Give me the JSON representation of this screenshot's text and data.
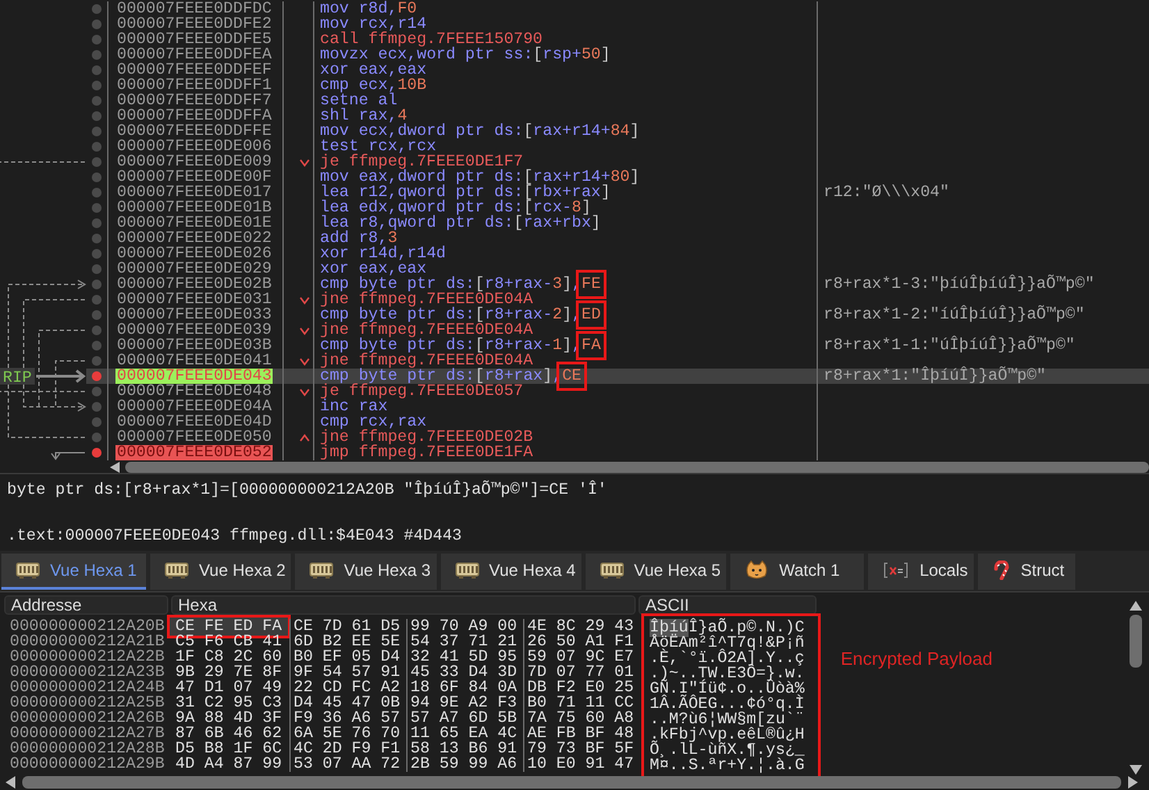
{
  "disassembly": {
    "rip_label": "RIP",
    "rows": [
      {
        "address": "000007FEEE0DDFDC",
        "instruction": "mov r8d,F0",
        "kind": "plain",
        "boxed": false,
        "breakpoint": false,
        "current": false
      },
      {
        "address": "000007FEEE0DDFE2",
        "instruction": "mov rcx,r14",
        "kind": "plain",
        "boxed": false,
        "breakpoint": false,
        "current": false
      },
      {
        "address": "000007FEEE0DDFE5",
        "instruction": "call ffmpeg.7FEEE150790",
        "kind": "branch",
        "boxed": false,
        "breakpoint": false,
        "current": false
      },
      {
        "address": "000007FEEE0DDFEA",
        "instruction": "movzx ecx,word ptr ss:[rsp+50]",
        "kind": "plain",
        "boxed": false,
        "breakpoint": false,
        "current": false
      },
      {
        "address": "000007FEEE0DDFEF",
        "instruction": "xor eax,eax",
        "kind": "plain",
        "boxed": false,
        "breakpoint": false,
        "current": false
      },
      {
        "address": "000007FEEE0DDFF1",
        "instruction": "cmp ecx,10B",
        "kind": "plain",
        "boxed": false,
        "breakpoint": false,
        "current": false
      },
      {
        "address": "000007FEEE0DDFF7",
        "instruction": "setne al",
        "kind": "plain",
        "boxed": false,
        "breakpoint": false,
        "current": false
      },
      {
        "address": "000007FEEE0DDFFA",
        "instruction": "shl rax,4",
        "kind": "plain",
        "boxed": false,
        "breakpoint": false,
        "current": false
      },
      {
        "address": "000007FEEE0DDFFE",
        "instruction": "mov ecx,dword ptr ds:[rax+r14+84]",
        "kind": "plain",
        "boxed": false,
        "breakpoint": false,
        "current": false
      },
      {
        "address": "000007FEEE0DE006",
        "instruction": "test rcx,rcx",
        "kind": "plain",
        "boxed": false,
        "breakpoint": false,
        "current": false
      },
      {
        "address": "000007FEEE0DE009",
        "instruction": "je ffmpeg.7FEEE0DE1F7",
        "kind": "jump_down",
        "boxed": false,
        "breakpoint": false,
        "current": false
      },
      {
        "address": "000007FEEE0DE00F",
        "instruction": "mov eax,dword ptr ds:[rax+r14+80]",
        "kind": "plain",
        "boxed": false,
        "breakpoint": false,
        "current": false
      },
      {
        "address": "000007FEEE0DE017",
        "instruction": "lea r12,qword ptr ds:[rbx+rax]",
        "kind": "plain",
        "boxed": false,
        "breakpoint": false,
        "current": false,
        "comment": "r12:\"Ø\\\\\\x04\""
      },
      {
        "address": "000007FEEE0DE01B",
        "instruction": "lea edx,qword ptr ds:[rcx-8]",
        "kind": "plain",
        "boxed": false,
        "breakpoint": false,
        "current": false
      },
      {
        "address": "000007FEEE0DE01E",
        "instruction": "lea r8,qword ptr ds:[rax+rbx]",
        "kind": "plain",
        "boxed": false,
        "breakpoint": false,
        "current": false
      },
      {
        "address": "000007FEEE0DE022",
        "instruction": "add r8,3",
        "kind": "plain",
        "boxed": false,
        "breakpoint": false,
        "current": false
      },
      {
        "address": "000007FEEE0DE026",
        "instruction": "xor r14d,r14d",
        "kind": "plain",
        "boxed": false,
        "breakpoint": false,
        "current": false
      },
      {
        "address": "000007FEEE0DE029",
        "instruction": "xor eax,eax",
        "kind": "plain",
        "boxed": false,
        "breakpoint": false,
        "current": false
      },
      {
        "address": "000007FEEE0DE02B",
        "instruction": "cmp byte ptr ds:[r8+rax-3],FE",
        "kind": "plain",
        "boxed": true,
        "breakpoint": false,
        "current": false,
        "comment": "r8+rax*1-3:\"þíúÎþíúÎ}}aÕ™p©\""
      },
      {
        "address": "000007FEEE0DE031",
        "instruction": "jne ffmpeg.7FEEE0DE04A",
        "kind": "jump_down",
        "boxed": false,
        "breakpoint": false,
        "current": false
      },
      {
        "address": "000007FEEE0DE033",
        "instruction": "cmp byte ptr ds:[r8+rax-2],ED",
        "kind": "plain",
        "boxed": true,
        "breakpoint": false,
        "current": false,
        "comment": "r8+rax*1-2:\"íúÎþíúÎ}}aÕ™p©\""
      },
      {
        "address": "000007FEEE0DE039",
        "instruction": "jne ffmpeg.7FEEE0DE04A",
        "kind": "jump_down",
        "boxed": false,
        "breakpoint": false,
        "current": false
      },
      {
        "address": "000007FEEE0DE03B",
        "instruction": "cmp byte ptr ds:[r8+rax-1],FA",
        "kind": "plain",
        "boxed": true,
        "breakpoint": false,
        "current": false,
        "comment": "r8+rax*1-1:\"úÎþíúÎ}}aÕ™p©\""
      },
      {
        "address": "000007FEEE0DE041",
        "instruction": "jne ffmpeg.7FEEE0DE04A",
        "kind": "jump_down",
        "boxed": false,
        "breakpoint": false,
        "current": false
      },
      {
        "address": "000007FEEE0DE043",
        "instruction": "cmp byte ptr ds:[r8+rax],CE",
        "kind": "plain",
        "boxed": true,
        "breakpoint": true,
        "current": true,
        "comment": "r8+rax*1:\"ÎþíúÎ}}aÕ™p©\""
      },
      {
        "address": "000007FEEE0DE048",
        "instruction": "je ffmpeg.7FEEE0DE057",
        "kind": "jump_down",
        "boxed": false,
        "breakpoint": false,
        "current": false
      },
      {
        "address": "000007FEEE0DE04A",
        "instruction": "inc rax",
        "kind": "plain",
        "boxed": false,
        "breakpoint": false,
        "current": false
      },
      {
        "address": "000007FEEE0DE04D",
        "instruction": "cmp rcx,rax",
        "kind": "plain",
        "boxed": false,
        "breakpoint": false,
        "current": false
      },
      {
        "address": "000007FEEE0DE050",
        "instruction": "jne ffmpeg.7FEEE0DE02B",
        "kind": "jump_up",
        "boxed": false,
        "breakpoint": false,
        "current": false
      },
      {
        "address": "000007FEEE0DE052",
        "instruction": "jmp ffmpeg.7FEEE0DE1FA",
        "kind": "branch",
        "boxed": false,
        "breakpoint": true,
        "current": false
      }
    ]
  },
  "info": {
    "lines": [
      "byte ptr ds:[r8+rax*1]=[000000000212A20B \"ÎþíúÎ}aÕ™p©\"]=CE 'Î'",
      ".text:000007FEEE0DE043 ffmpeg.dll:$4E043 #4D443"
    ]
  },
  "tabs": [
    {
      "label": "Vue Hexa 1",
      "kind": "dump",
      "selected": true
    },
    {
      "label": "Vue Hexa 2",
      "kind": "dump",
      "selected": false
    },
    {
      "label": "Vue Hexa 3",
      "kind": "dump",
      "selected": false
    },
    {
      "label": "Vue Hexa 4",
      "kind": "dump",
      "selected": false
    },
    {
      "label": "Vue Hexa 5",
      "kind": "dump",
      "selected": false
    },
    {
      "label": "Watch 1",
      "kind": "watch",
      "selected": false
    },
    {
      "label": "Locals",
      "kind": "locals",
      "selected": false
    },
    {
      "label": "Struct",
      "kind": "struct",
      "selected": false
    }
  ],
  "hex": {
    "columns": [
      "Addresse",
      "Hexa",
      "ASCII"
    ],
    "note": "Encrypted Payload",
    "rows": [
      {
        "address": "000000000212A20B",
        "groups": [
          "CE FE ED FA",
          "CE 7D 61 D5",
          "99 70 A9 00",
          "4E 8C 29 43"
        ],
        "ascii": "ÎþíúÎ}aÕ.p©.N.)C",
        "boxed": true
      },
      {
        "address": "000000000212A21B",
        "groups": [
          "C5 F6 CB 41",
          "6D B2 EE 5E",
          "54 37 71 21",
          "26 50 A1 F1"
        ],
        "ascii": "ÅöËAm²î^T7q!&P¡ñ",
        "boxed": false
      },
      {
        "address": "000000000212A22B",
        "groups": [
          "1F C8 2C 60",
          "B0 EF 05 D4",
          "32 41 5D 95",
          "59 07 9C E7"
        ],
        "ascii": ".È,`°ï.Ô2A].Y..ç",
        "boxed": false
      },
      {
        "address": "000000000212A23B",
        "groups": [
          "9B 29 7E 8F",
          "9F 54 57 91",
          "45 33 D4 3D",
          "7D 07 77 01"
        ],
        "ascii": ".)~..TW.E3Ô=}.w.",
        "boxed": false
      },
      {
        "address": "000000000212A24B",
        "groups": [
          "47 D1 07 49",
          "22 CD FC A2",
          "18 6F 84 0A",
          "DB F2 E0 25"
        ],
        "ascii": "GÑ.I\"Íü¢.o..Ûòà%",
        "boxed": false
      },
      {
        "address": "000000000212A25B",
        "groups": [
          "31 C2 95 C3",
          "D4 45 47 0B",
          "94 9E A2 F3",
          "B0 71 11 CC"
        ],
        "ascii": "1Â.ÃÔEG...¢ó°q.Ì",
        "boxed": false
      },
      {
        "address": "000000000212A26B",
        "groups": [
          "9A 88 4D 3F",
          "F9 36 A6 57",
          "57 A7 6D 5B",
          "7A 75 60 A8"
        ],
        "ascii": "..M?ù6¦WW§m[zu`¨",
        "boxed": false
      },
      {
        "address": "000000000212A27B",
        "groups": [
          "87 6B 46 62",
          "6A 5E 76 70",
          "11 65 EA 4C",
          "AE FB BF 48"
        ],
        "ascii": ".kFbj^vp.eêL®û¿H",
        "boxed": false
      },
      {
        "address": "000000000212A28B",
        "groups": [
          "D5 B8 1F 6C",
          "4C 2D F9 F1",
          "58 13 B6 91",
          "79 73 BF 5F"
        ],
        "ascii": "Õ¸.lL-ùñX.¶.ys¿_",
        "boxed": false
      },
      {
        "address": "000000000212A29B",
        "groups": [
          "4D A4 87 99",
          "53 07 AA 72",
          "2B 59 99 A6",
          "10 E0 91 47"
        ],
        "ascii": "M¤..S.ªr+Y.¦.à.G",
        "boxed": false
      }
    ]
  }
}
